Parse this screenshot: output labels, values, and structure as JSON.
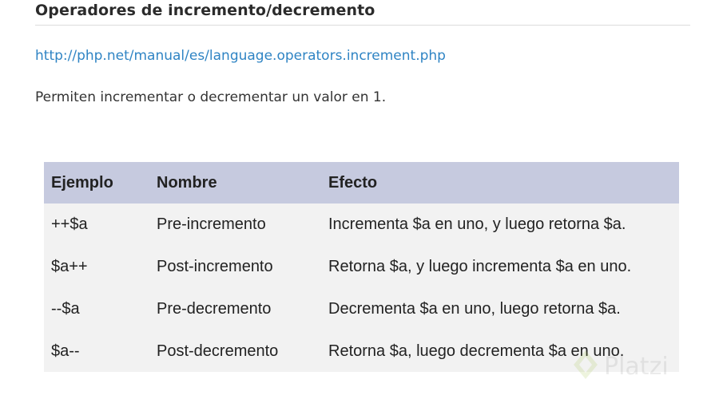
{
  "heading": "Operadores de incremento/decremento",
  "link": {
    "text": "http://php.net/manual/es/language.operators.increment.php",
    "href": "http://php.net/manual/es/language.operators.increment.php"
  },
  "intro": "Permiten incrementar o decrementar un valor en 1.",
  "table": {
    "headers": [
      "Ejemplo",
      "Nombre",
      "Efecto"
    ],
    "rows": [
      [
        "++$a",
        "Pre-incremento",
        "Incrementa $a en uno, y luego retorna $a."
      ],
      [
        "$a++",
        "Post-incremento",
        "Retorna $a, y luego incrementa $a en uno."
      ],
      [
        "--$a",
        "Pre-decremento",
        "Decrementa $a en uno, luego retorna $a."
      ],
      [
        "$a--",
        "Post-decremento",
        "Retorna $a, luego decrementa $a en uno."
      ]
    ]
  },
  "watermark": {
    "text": "Platzi",
    "icon": "platzi-logo-icon"
  },
  "colors": {
    "link": "#2f84c4",
    "table_header_bg": "#c6cadf",
    "table_body_bg": "#f2f2f2"
  }
}
